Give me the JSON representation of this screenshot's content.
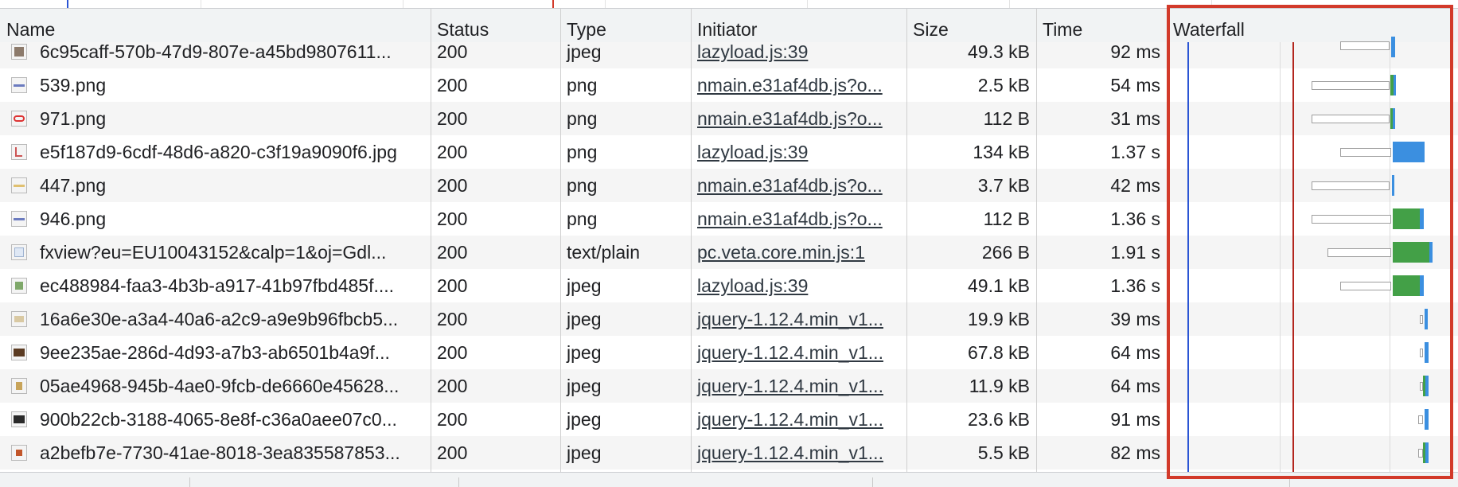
{
  "columns": {
    "name": "Name",
    "status": "Status",
    "type": "Type",
    "initiator": "Initiator",
    "size": "Size",
    "time": "Time",
    "waterfall": "Waterfall"
  },
  "requests": [
    {
      "name": "6c95caff-570b-47d9-807e-a45bd9807611...",
      "status": "200",
      "type": "jpeg",
      "initiator": "lazyload.js:39",
      "size": "49.3 kB",
      "time": "92 ms",
      "icon": "jpeg-thumbnail-icon"
    },
    {
      "name": "539.png",
      "status": "200",
      "type": "png",
      "initiator": "nmain.e31af4db.js?o...",
      "size": "2.5 kB",
      "time": "54 ms",
      "icon": "png-thumbnail-icon"
    },
    {
      "name": "971.png",
      "status": "200",
      "type": "png",
      "initiator": "nmain.e31af4db.js?o...",
      "size": "112 B",
      "time": "31 ms",
      "icon": "png-thumbnail-icon"
    },
    {
      "name": "e5f187d9-6cdf-48d6-a820-c3f19a9090f6.jpg",
      "status": "200",
      "type": "png",
      "initiator": "lazyload.js:39",
      "size": "134 kB",
      "time": "1.37 s",
      "icon": "png-thumbnail-icon"
    },
    {
      "name": "447.png",
      "status": "200",
      "type": "png",
      "initiator": "nmain.e31af4db.js?o...",
      "size": "3.7 kB",
      "time": "42 ms",
      "icon": "png-thumbnail-icon"
    },
    {
      "name": "946.png",
      "status": "200",
      "type": "png",
      "initiator": "nmain.e31af4db.js?o...",
      "size": "112 B",
      "time": "1.36 s",
      "icon": "png-thumbnail-icon"
    },
    {
      "name": "fxview?eu=EU10043152&calp=1&oj=Gdl...",
      "status": "200",
      "type": "text/plain",
      "initiator": "pc.veta.core.min.js:1",
      "size": "266 B",
      "time": "1.91 s",
      "icon": "document-icon"
    },
    {
      "name": "ec488984-faa3-4b3b-a917-41b97fbd485f....",
      "status": "200",
      "type": "jpeg",
      "initiator": "lazyload.js:39",
      "size": "49.1 kB",
      "time": "1.36 s",
      "icon": "jpeg-thumbnail-icon"
    },
    {
      "name": "16a6e30e-a3a4-40a6-a2c9-a9e9b96fbcb5...",
      "status": "200",
      "type": "jpeg",
      "initiator": "jquery-1.12.4.min_v1...",
      "size": "19.9 kB",
      "time": "39 ms",
      "icon": "jpeg-thumbnail-icon"
    },
    {
      "name": "9ee235ae-286d-4d93-a7b3-ab6501b4a9f...",
      "status": "200",
      "type": "jpeg",
      "initiator": "jquery-1.12.4.min_v1...",
      "size": "67.8 kB",
      "time": "64 ms",
      "icon": "jpeg-thumbnail-icon"
    },
    {
      "name": "05ae4968-945b-4ae0-9fcb-de6660e45628...",
      "status": "200",
      "type": "jpeg",
      "initiator": "jquery-1.12.4.min_v1...",
      "size": "11.9 kB",
      "time": "64 ms",
      "icon": "jpeg-thumbnail-icon"
    },
    {
      "name": "900b22cb-3188-4065-8e8f-c36a0aee07c0...",
      "status": "200",
      "type": "jpeg",
      "initiator": "jquery-1.12.4.min_v1...",
      "size": "23.6 kB",
      "time": "91 ms",
      "icon": "jpeg-thumbnail-icon"
    },
    {
      "name": "a2befb7e-7730-41ae-8018-3ea835587853...",
      "status": "200",
      "type": "jpeg",
      "initiator": "jquery-1.12.4.min_v1...",
      "size": "5.5 kB",
      "time": "82 ms",
      "icon": "jpeg-thumbnail-icon"
    }
  ],
  "colors": {
    "accent_highlight": "#d23a2a",
    "dom_content_loaded_line": "#2b55d4",
    "load_line": "#b3261e",
    "download_green": "#43a047",
    "download_blue": "#3b8fe0"
  }
}
